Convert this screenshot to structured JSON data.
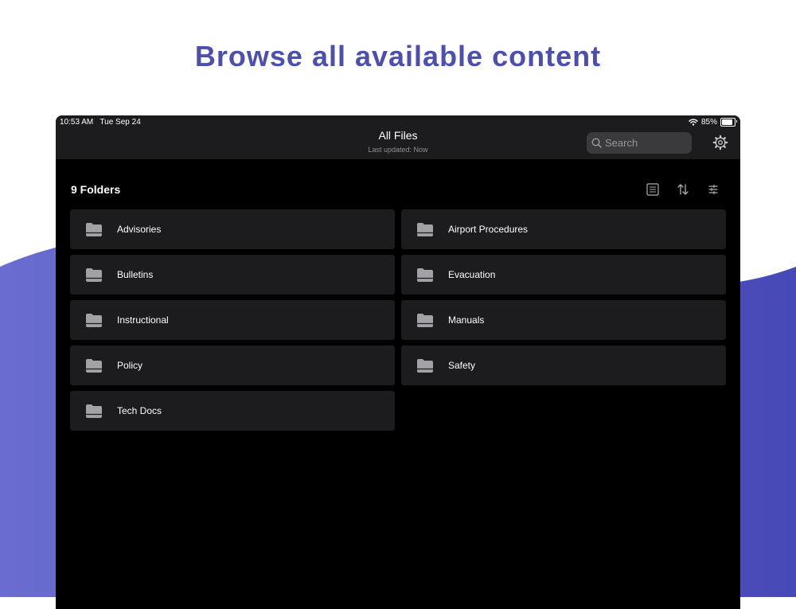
{
  "headline": "Browse all available content",
  "status": {
    "time": "10:53 AM",
    "date": "Tue Sep 24",
    "battery_percent": "85%",
    "battery_level": 0.85
  },
  "nav": {
    "title": "All Files",
    "subtitle": "Last updated: Now"
  },
  "search": {
    "placeholder": "Search",
    "value": ""
  },
  "toolbar": {
    "folder_count": "9 Folders"
  },
  "folders": [
    {
      "name": "Advisories"
    },
    {
      "name": "Airport Procedures"
    },
    {
      "name": "Bulletins"
    },
    {
      "name": "Evacuation"
    },
    {
      "name": "Instructional"
    },
    {
      "name": "Manuals"
    },
    {
      "name": "Policy"
    },
    {
      "name": "Safety"
    },
    {
      "name": "Tech Docs"
    }
  ],
  "colors": {
    "headline": "#4d4fae",
    "background_wave": "#5a5cc4",
    "device_background": "#000000",
    "bar_background": "#1c1c1e",
    "folder_card": "#1c1c1e",
    "folder_icon": "#a2a2a6"
  },
  "icons": {
    "search": "search-icon",
    "settings": "gear-icon",
    "list_view": "list-view-icon",
    "sort": "sort-icon",
    "filter": "filter-icon",
    "folder": "folder-icon",
    "wifi": "wifi-icon",
    "battery": "battery-icon"
  }
}
